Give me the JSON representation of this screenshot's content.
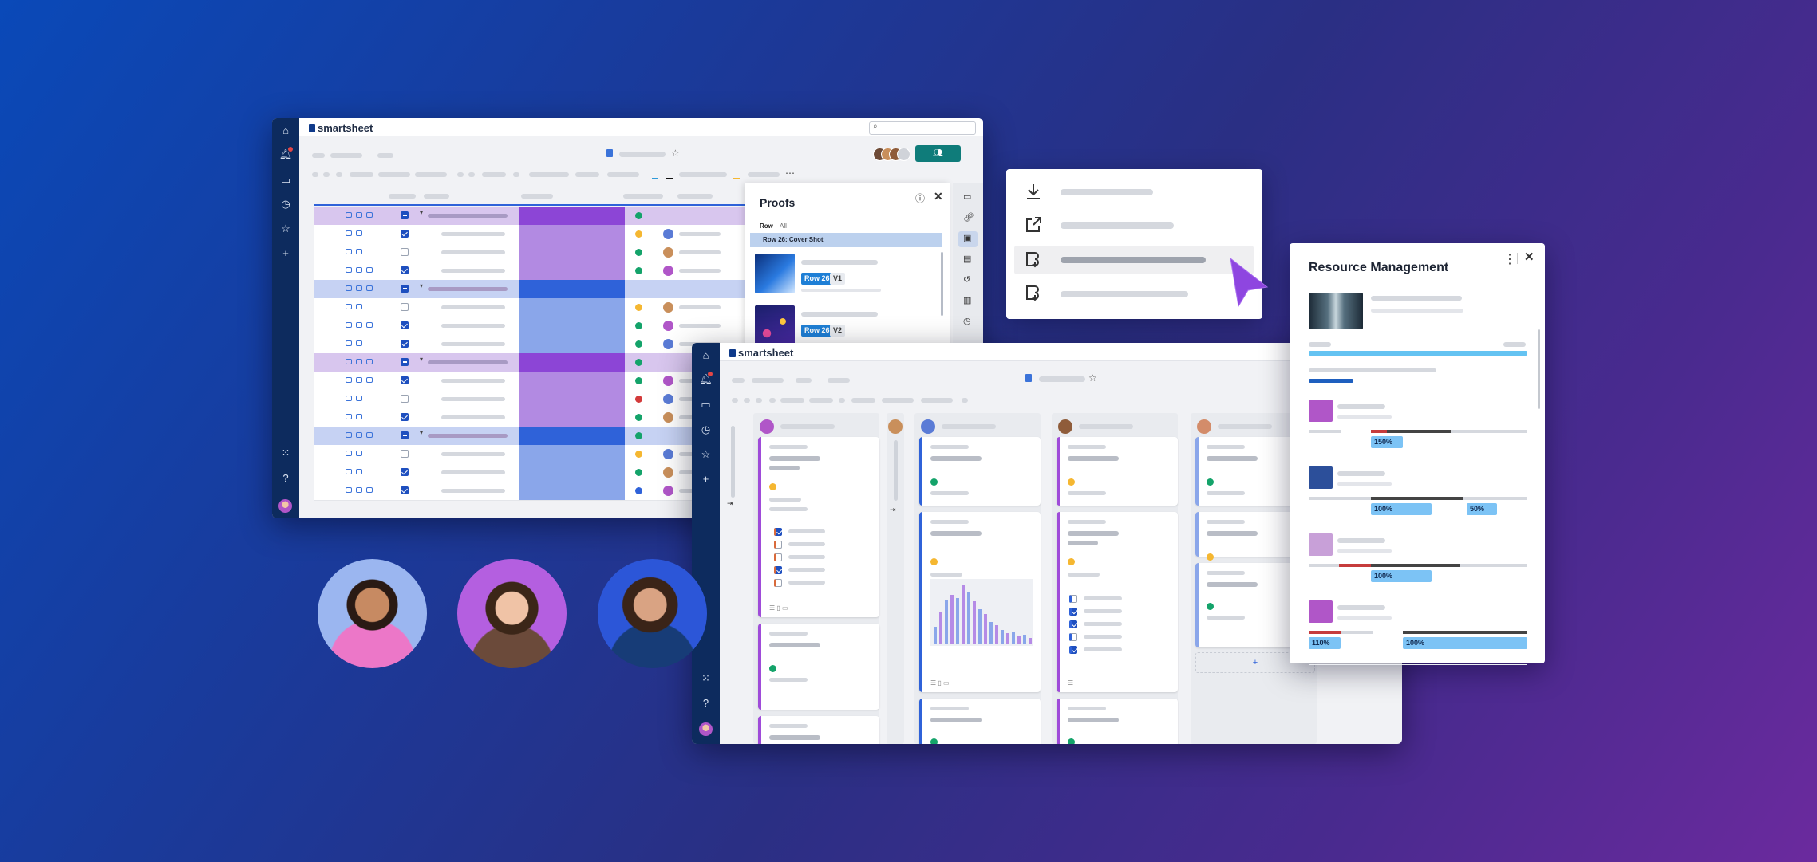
{
  "brand": {
    "name": "smartsheet"
  },
  "proofs": {
    "title": "Proofs",
    "filters": [
      "Row",
      "All"
    ],
    "selected_row": "Row 26: Cover Shot",
    "items": [
      {
        "row_tag": "Row 26",
        "version": "V1"
      },
      {
        "row_tag": "Row 26",
        "version": "V2"
      }
    ]
  },
  "resource": {
    "title": "Resource Management",
    "people": [
      {
        "allocations": [
          "150%"
        ]
      },
      {
        "allocations": [
          "100%",
          "50%"
        ]
      },
      {
        "allocations": [
          "100%"
        ]
      },
      {
        "allocations": [
          "110%",
          "100%"
        ]
      }
    ]
  },
  "board": {
    "add_label": "+"
  },
  "colors": {
    "accent_purple": "#9f4bd9",
    "accent_blue": "#2f62d9",
    "status_green": "#14a36a",
    "status_yellow": "#f5b731",
    "status_red": "#d33b3b",
    "tag_blue": "#7cc3f5"
  }
}
